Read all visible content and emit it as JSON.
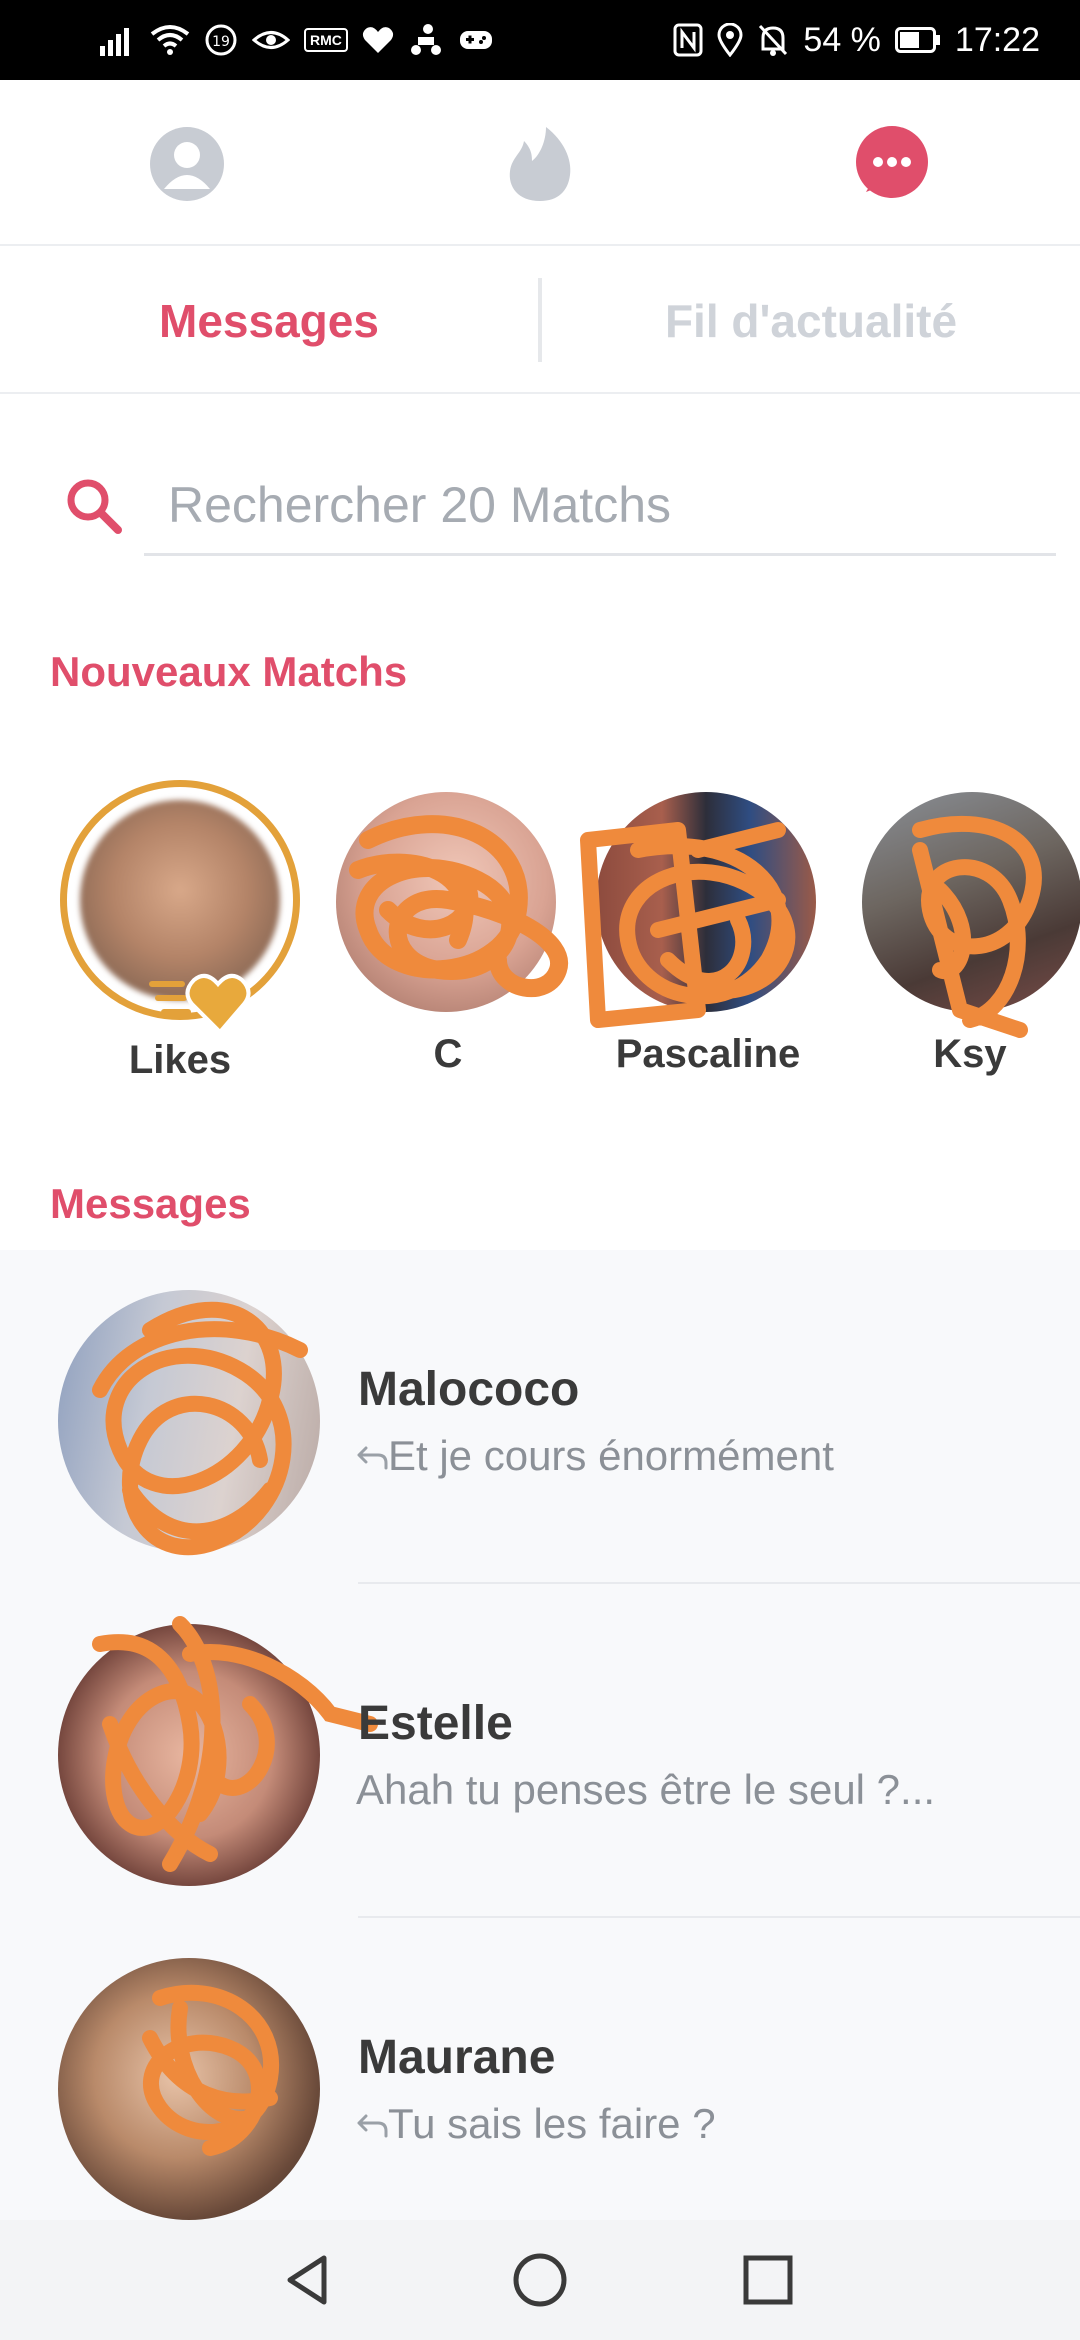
{
  "status_bar": {
    "battery": "54 %",
    "time": "17:22",
    "rmc_label": "RMC"
  },
  "top_nav": {
    "active": "messages",
    "accent_color": "#e04e6b",
    "inactive_color": "#cfd3d9"
  },
  "tabs": {
    "messages": "Messages",
    "feed": "Fil d'actualité"
  },
  "search": {
    "placeholder": "Rechercher 20 Matchs"
  },
  "new_matches": {
    "title": "Nouveaux Matchs",
    "likes_label": "Likes",
    "items": [
      {
        "name": "C"
      },
      {
        "name": "Pascaline"
      },
      {
        "name": "Ksy"
      }
    ]
  },
  "messages": {
    "title": "Messages",
    "items": [
      {
        "name": "Malococo",
        "preview": "Et je cours énormément",
        "reply_icon": true
      },
      {
        "name": "Estelle",
        "preview": "Ahah tu penses être le seul ?...",
        "reply_icon": false
      },
      {
        "name": "Maurane",
        "preview": "Tu sais les faire ?",
        "reply_icon": true
      }
    ]
  }
}
